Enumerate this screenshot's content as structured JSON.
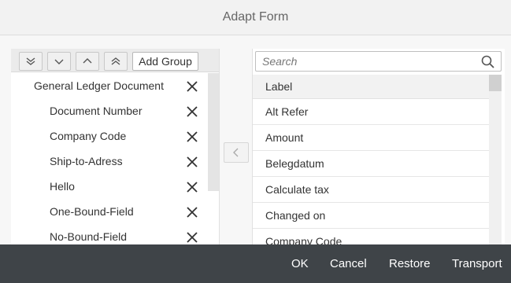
{
  "dialog": {
    "title": "Adapt Form"
  },
  "toolbar": {
    "add_group_label": "Add Group",
    "icons": [
      "double-chevron-down-icon",
      "chevron-down-icon",
      "chevron-up-icon",
      "double-chevron-up-icon"
    ]
  },
  "tree": {
    "group": "General Ledger Document",
    "fields": [
      "Document Number",
      "Company Code",
      "Ship-to-Adress",
      "Hello",
      "One-Bound-Field",
      "No-Bound-Field"
    ]
  },
  "search": {
    "placeholder": "Search",
    "value": ""
  },
  "available": {
    "header": "Label",
    "items": [
      "Alt Refer",
      "Amount",
      "Belegdatum",
      "Calculate tax",
      "Changed on",
      "Company Code"
    ]
  },
  "footer": {
    "ok": "OK",
    "cancel": "Cancel",
    "restore": "Restore",
    "transport": "Transport"
  },
  "colors": {
    "footer_bg": "#3f4448",
    "header_bg": "#f2f2f2"
  }
}
